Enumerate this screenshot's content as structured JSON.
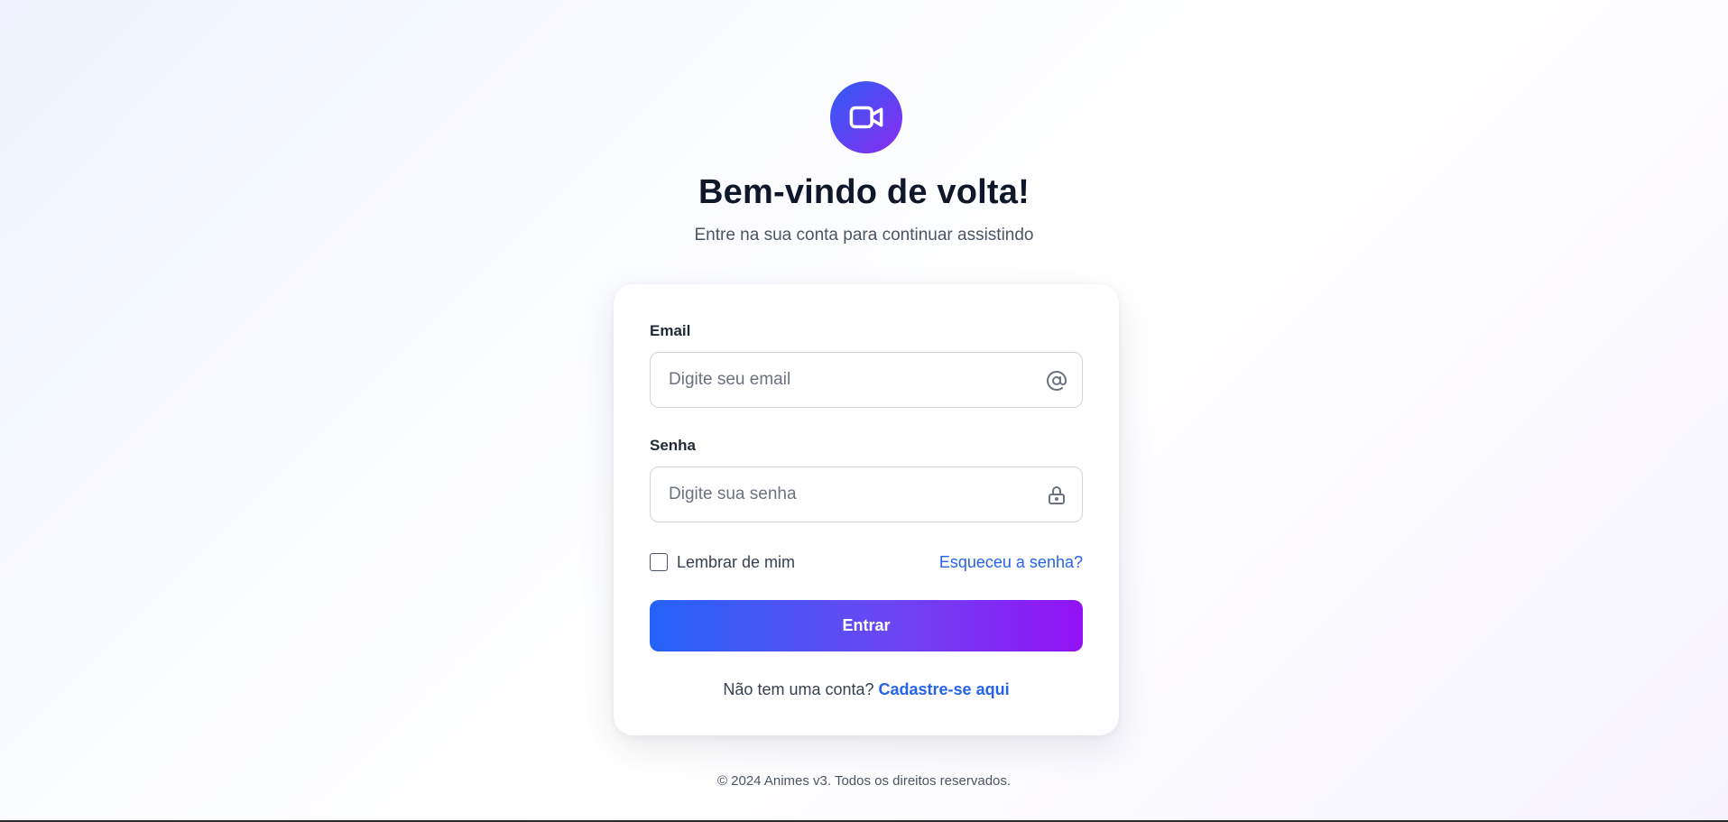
{
  "header": {
    "logo_icon": "video-camera-icon",
    "title": "Bem-vindo de volta!",
    "subtitle": "Entre na sua conta para continuar assistindo"
  },
  "form": {
    "email": {
      "label": "Email",
      "placeholder": "Digite seu email",
      "value": "",
      "icon": "at-sign-icon"
    },
    "password": {
      "label": "Senha",
      "placeholder": "Digite sua senha",
      "value": "",
      "icon": "lock-icon"
    },
    "remember_label": "Lembrar de mim",
    "remember_checked": false,
    "forgot_label": "Esqueceu a senha?",
    "submit_label": "Entrar",
    "signup_prompt": "Não tem uma conta?",
    "signup_link": "Cadastre-se aqui"
  },
  "footer": {
    "text": "© 2024 Animes v3. Todos os direitos reservados."
  },
  "colors": {
    "link": "#2563eb",
    "button_gradient_start": "#2463f8",
    "button_gradient_end": "#9312f4",
    "logo_gradient_start": "#2f5cf6",
    "logo_gradient_end": "#8a2cf0"
  }
}
